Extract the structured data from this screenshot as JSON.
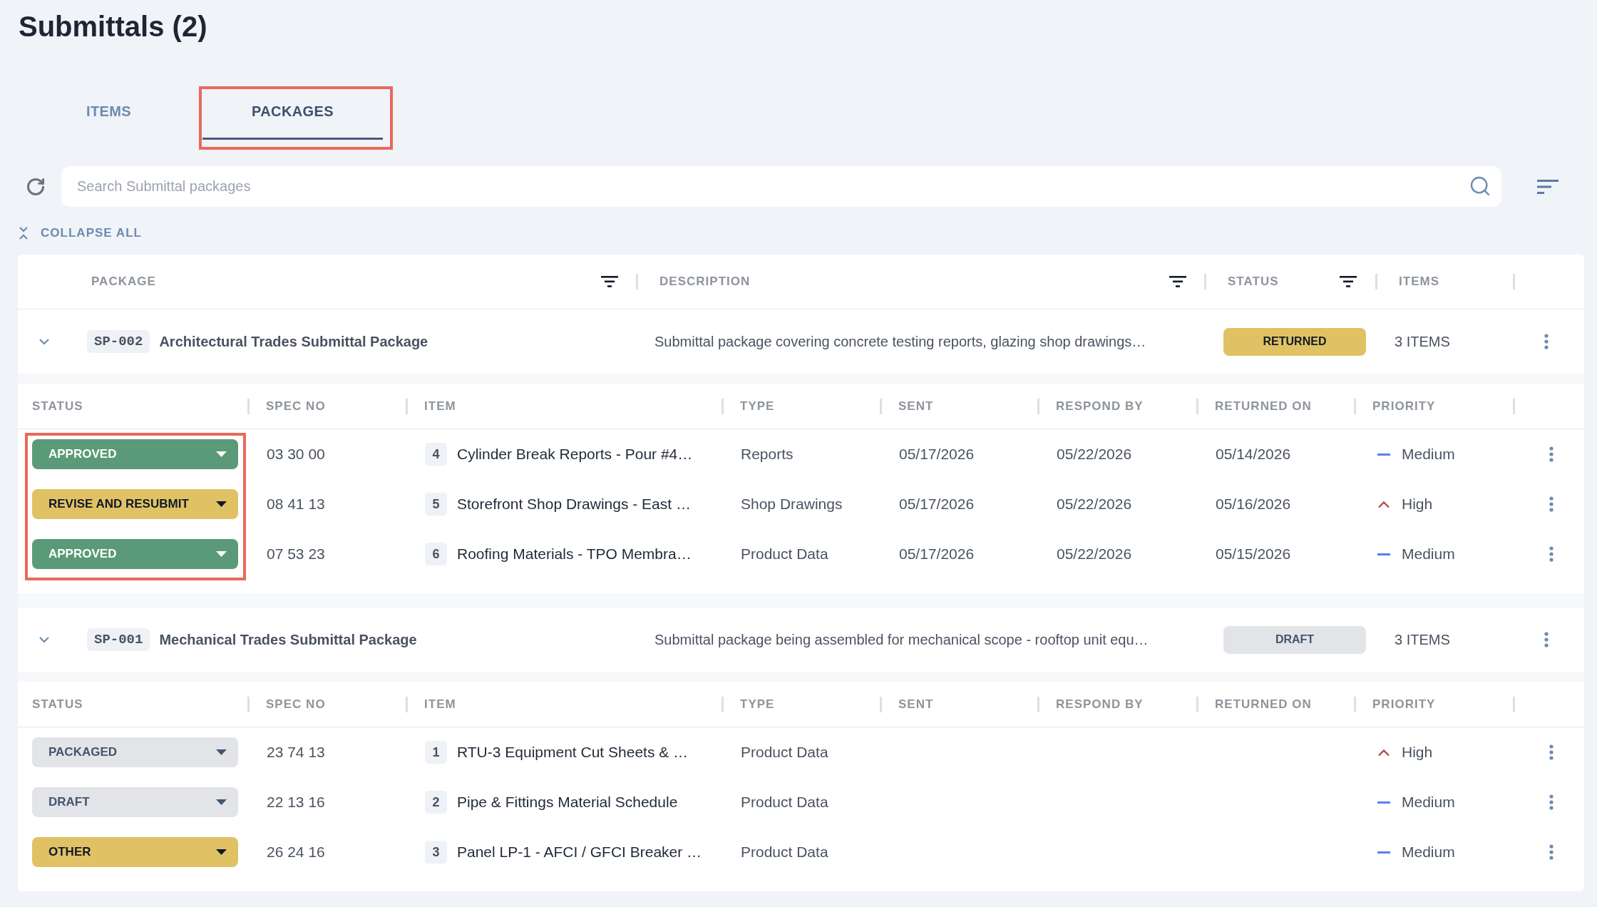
{
  "page": {
    "title": "Submittals (2)"
  },
  "tabs": [
    {
      "label": "ITEMS",
      "selected": false,
      "highlighted": false
    },
    {
      "label": "PACKAGES",
      "selected": true,
      "highlighted": true
    }
  ],
  "search": {
    "placeholder": "Search Submittal packages"
  },
  "collapse_all": {
    "label": "COLLAPSE ALL"
  },
  "table": {
    "columns": [
      {
        "label": "PACKAGE",
        "filterable": true
      },
      {
        "label": "DESCRIPTION",
        "filterable": true
      },
      {
        "label": "STATUS",
        "filterable": true
      },
      {
        "label": "ITEMS",
        "filterable": false
      }
    ],
    "packages": [
      {
        "expanded": true,
        "code": "SP-002",
        "name": "Architectural Trades Submittal Package",
        "description": "Submittal package covering concrete testing reports, glazing shop drawings…",
        "status": {
          "label": "RETURNED",
          "color": "#e0c264"
        },
        "item_count": "3 ITEMS",
        "status_column_highlighted": true,
        "columns": [
          "STATUS",
          "SPEC NO",
          "ITEM",
          "TYPE",
          "SENT",
          "RESPOND BY",
          "RETURNED ON",
          "PRIORITY"
        ],
        "rows": [
          {
            "status": {
              "label": "APPROVED",
              "color": "#5a9a78"
            },
            "spec_no": "03 30 00",
            "number": "4",
            "item": "Cylinder Break Reports - Pour #4…",
            "type": "Reports",
            "sent": "05/17/2026",
            "respond_by": "05/22/2026",
            "returned_on": "05/14/2026",
            "priority": {
              "kind": "medium",
              "label": "Medium"
            }
          },
          {
            "status": {
              "label": "REVISE AND RESUBMIT",
              "color": "#e0c264"
            },
            "spec_no": "08 41 13",
            "number": "5",
            "item": "Storefront Shop Drawings - East …",
            "type": "Shop Drawings",
            "sent": "05/17/2026",
            "respond_by": "05/22/2026",
            "returned_on": "05/16/2026",
            "priority": {
              "kind": "high",
              "label": "High"
            }
          },
          {
            "status": {
              "label": "APPROVED",
              "color": "#5a9a78"
            },
            "spec_no": "07 53 23",
            "number": "6",
            "item": "Roofing Materials - TPO Membra…",
            "type": "Product Data",
            "sent": "05/17/2026",
            "respond_by": "05/22/2026",
            "returned_on": "05/15/2026",
            "priority": {
              "kind": "medium",
              "label": "Medium"
            }
          }
        ]
      },
      {
        "expanded": true,
        "code": "SP-001",
        "name": "Mechanical Trades Submittal Package",
        "description": "Submittal package being assembled for mechanical scope - rooftop unit equ…",
        "status": {
          "label": "DRAFT",
          "color": "#e2e4e8"
        },
        "item_count": "3 ITEMS",
        "status_column_highlighted": false,
        "columns": [
          "STATUS",
          "SPEC NO",
          "ITEM",
          "TYPE",
          "SENT",
          "RESPOND BY",
          "RETURNED ON",
          "PRIORITY"
        ],
        "rows": [
          {
            "status": {
              "label": "PACKAGED",
              "color": "#e2e4e8"
            },
            "spec_no": "23 74 13",
            "number": "1",
            "item": "RTU-3 Equipment Cut Sheets & …",
            "type": "Product Data",
            "priority": {
              "kind": "high",
              "label": "High"
            }
          },
          {
            "status": {
              "label": "DRAFT",
              "color": "#e2e4e8"
            },
            "spec_no": "22 13 16",
            "number": "2",
            "item": "Pipe & Fittings Material Schedule",
            "type": "Product Data",
            "priority": {
              "kind": "medium",
              "label": "Medium"
            }
          },
          {
            "status": {
              "label": "OTHER",
              "color": "#e0c264"
            },
            "spec_no": "26 24 16",
            "number": "3",
            "item": "Panel LP-1 - AFCI / GFCI Breaker …",
            "type": "Product Data",
            "priority": {
              "kind": "medium",
              "label": "Medium"
            }
          }
        ]
      }
    ]
  }
}
